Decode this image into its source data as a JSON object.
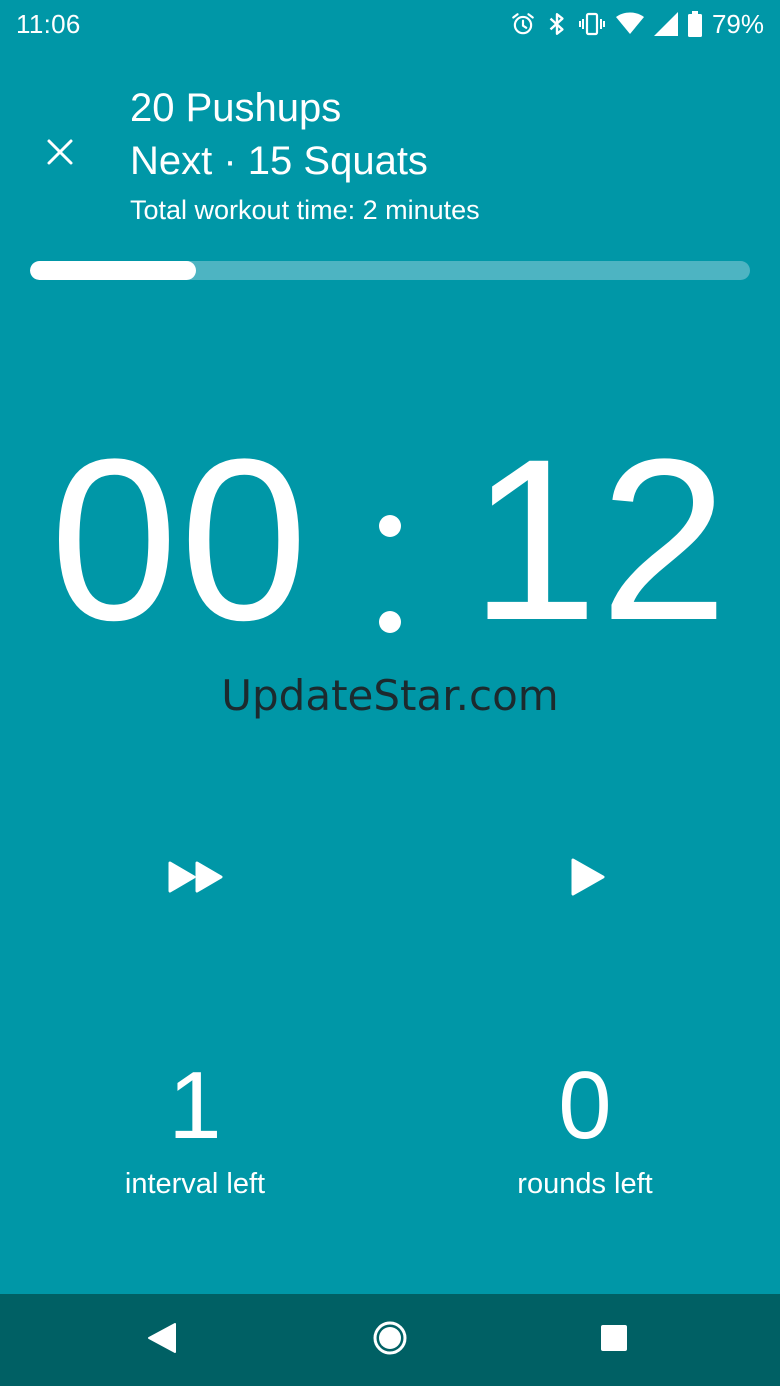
{
  "status_bar": {
    "time": "11:06",
    "battery_percent": "79%",
    "icons": [
      "alarm-icon",
      "bluetooth-icon",
      "vibrate-icon",
      "wifi-icon",
      "cell-signal-icon",
      "battery-icon"
    ]
  },
  "header": {
    "close_icon": "close-icon",
    "exercise": "20 Pushups",
    "next_label": "Next · 15 Squats",
    "total_time": "Total workout time: 2 minutes"
  },
  "progress": {
    "fraction": 0.23
  },
  "timer": {
    "minutes": "00",
    "seconds": "12"
  },
  "watermark": "UpdateStar.com",
  "controls": {
    "skip_icon": "fast-forward-icon",
    "play_icon": "play-icon"
  },
  "counters": {
    "intervals_value": "1",
    "intervals_label": "interval left",
    "rounds_value": "0",
    "rounds_label": "rounds left"
  },
  "nav_bar": {
    "icons": [
      "back-icon",
      "home-icon",
      "recents-icon"
    ]
  },
  "colors": {
    "background": "#0097a7",
    "progress_track": "#4db4c2",
    "nav_bar": "#006064",
    "foreground": "#ffffff"
  }
}
